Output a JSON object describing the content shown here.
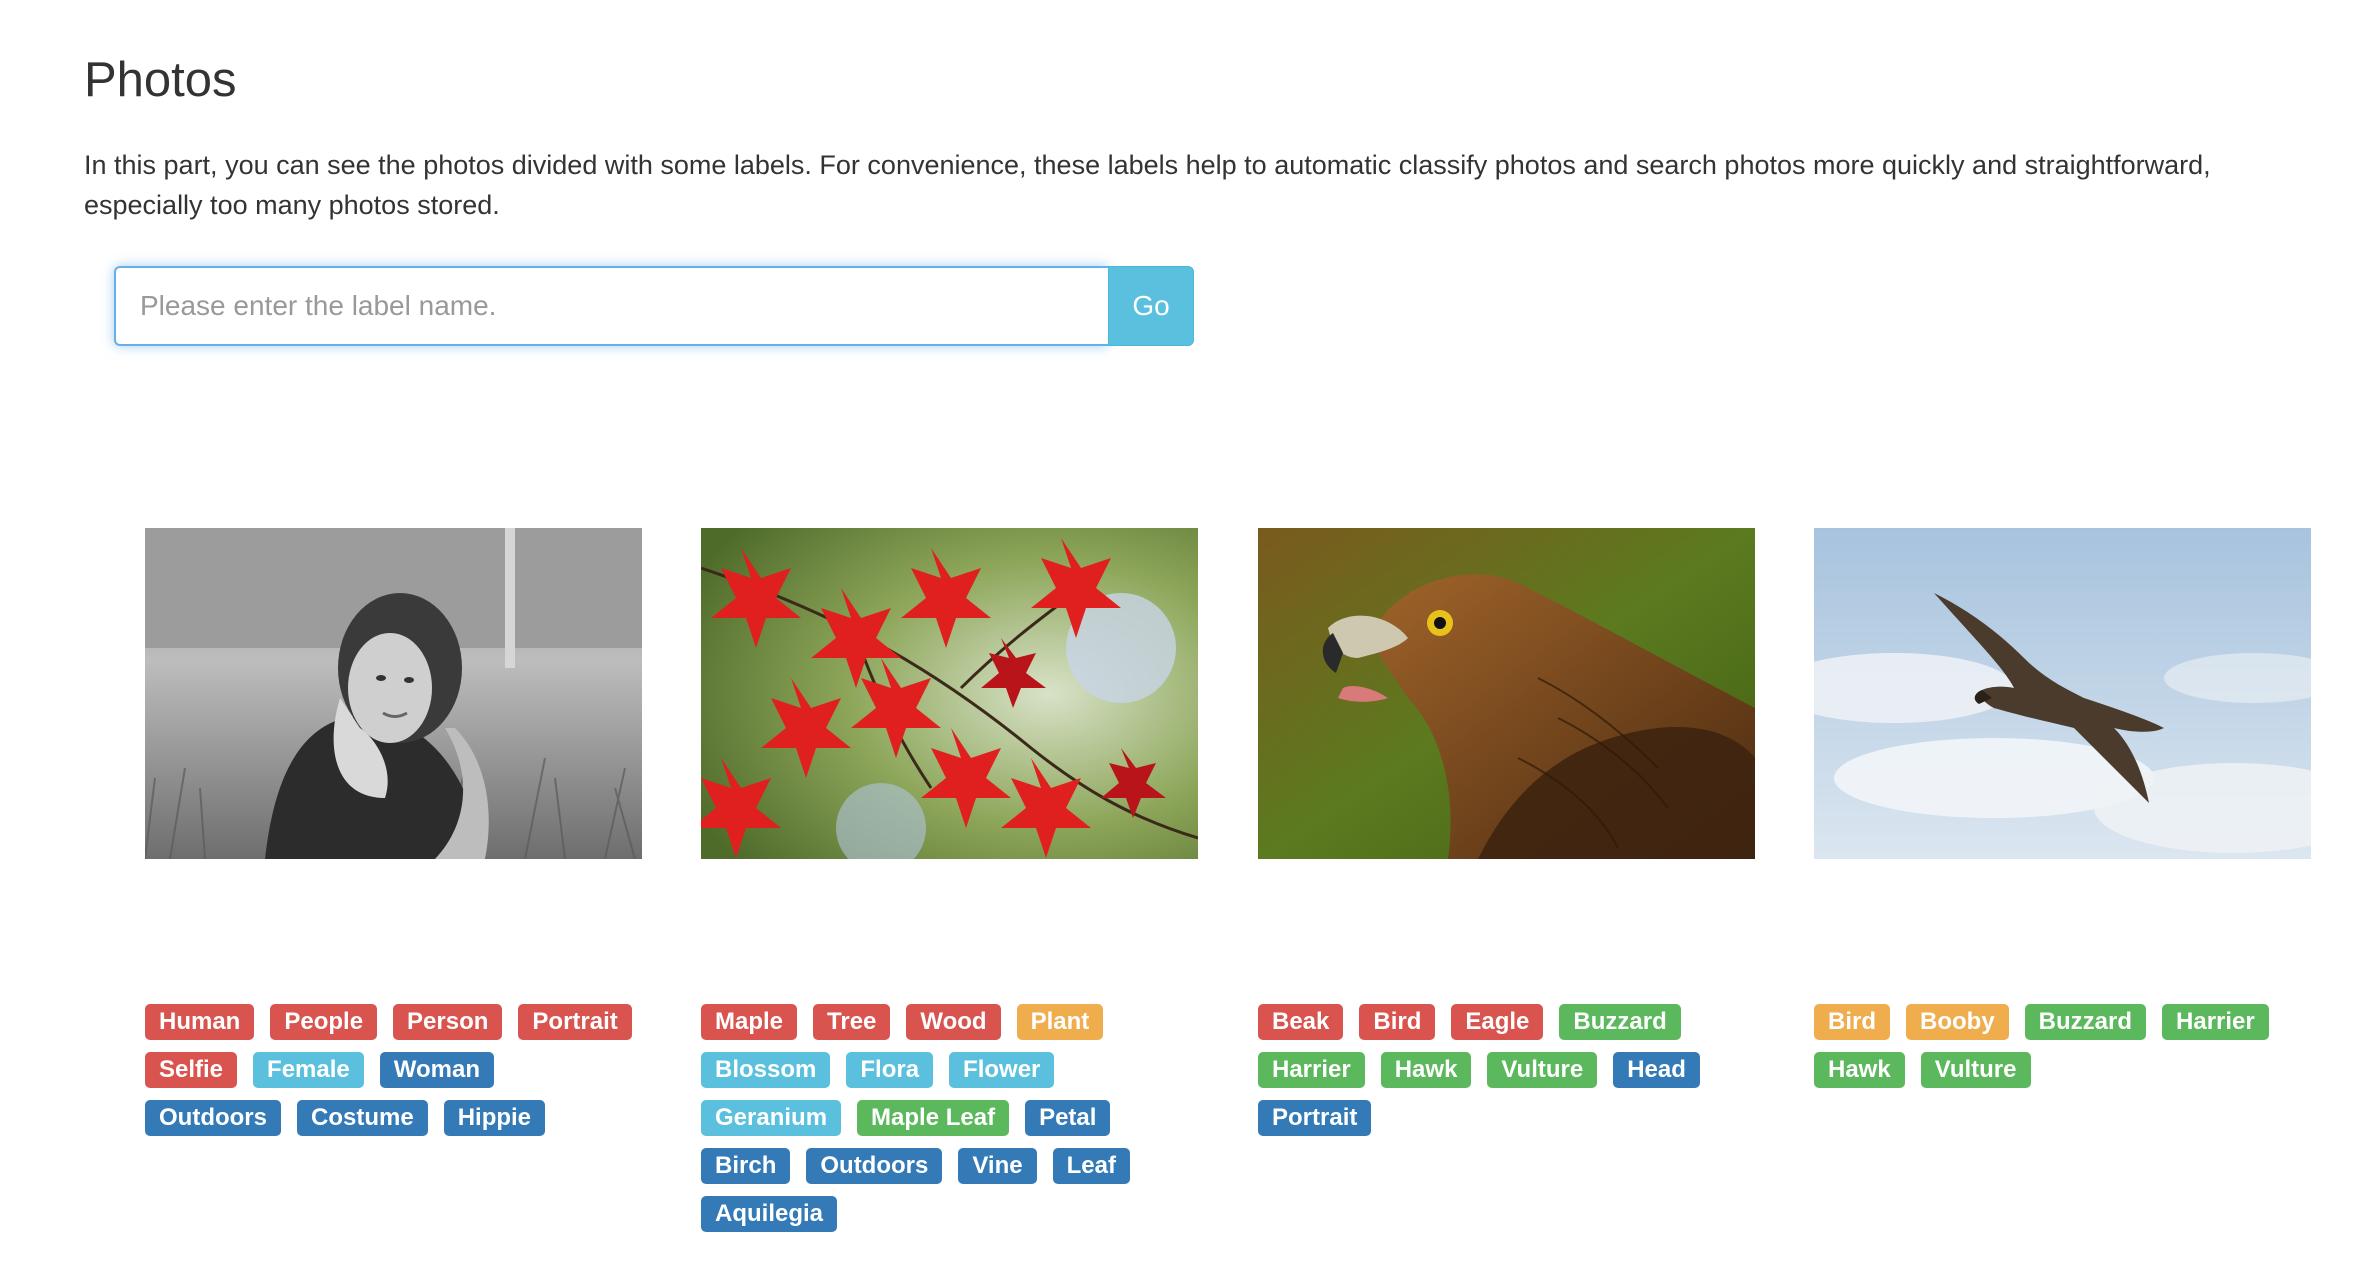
{
  "page": {
    "title": "Photos",
    "intro": "In this part, you can see the photos divided with some labels. For convenience, these labels help to automatic classify photos and search photos more quickly and straightforward, especially too many photos stored."
  },
  "search": {
    "placeholder": "Please enter the label name.",
    "button_label": "Go"
  },
  "colors": {
    "danger": "#d9534f",
    "info": "#5bc0de",
    "primary": "#337ab7",
    "warning": "#f0ad4e",
    "success": "#5cb85c"
  },
  "photos": [
    {
      "subject": "woman-lying-in-grass",
      "labels": [
        {
          "text": "Human",
          "style": "danger"
        },
        {
          "text": "People",
          "style": "danger"
        },
        {
          "text": "Person",
          "style": "danger"
        },
        {
          "text": "Portrait",
          "style": "danger"
        },
        {
          "text": "Selfie",
          "style": "danger"
        },
        {
          "text": "Female",
          "style": "info"
        },
        {
          "text": "Woman",
          "style": "primary"
        },
        {
          "text": "Outdoors",
          "style": "primary"
        },
        {
          "text": "Costume",
          "style": "primary"
        },
        {
          "text": "Hippie",
          "style": "primary"
        }
      ]
    },
    {
      "subject": "red-maple-leaves",
      "labels": [
        {
          "text": "Maple",
          "style": "danger"
        },
        {
          "text": "Tree",
          "style": "danger"
        },
        {
          "text": "Wood",
          "style": "danger"
        },
        {
          "text": "Plant",
          "style": "warning"
        },
        {
          "text": "Blossom",
          "style": "info"
        },
        {
          "text": "Flora",
          "style": "info"
        },
        {
          "text": "Flower",
          "style": "info"
        },
        {
          "text": "Geranium",
          "style": "info"
        },
        {
          "text": "Maple Leaf",
          "style": "success"
        },
        {
          "text": "Petal",
          "style": "primary"
        },
        {
          "text": "Birch",
          "style": "primary"
        },
        {
          "text": "Outdoors",
          "style": "primary"
        },
        {
          "text": "Vine",
          "style": "primary"
        },
        {
          "text": "Leaf",
          "style": "primary"
        },
        {
          "text": "Aquilegia",
          "style": "primary"
        }
      ]
    },
    {
      "subject": "eagle-head",
      "labels": [
        {
          "text": "Beak",
          "style": "danger"
        },
        {
          "text": "Bird",
          "style": "danger"
        },
        {
          "text": "Eagle",
          "style": "danger"
        },
        {
          "text": "Buzzard",
          "style": "success"
        },
        {
          "text": "Harrier",
          "style": "success"
        },
        {
          "text": "Hawk",
          "style": "success"
        },
        {
          "text": "Vulture",
          "style": "success"
        },
        {
          "text": "Head",
          "style": "primary"
        },
        {
          "text": "Portrait",
          "style": "primary"
        }
      ]
    },
    {
      "subject": "bird-flying-in-sky",
      "labels": [
        {
          "text": "Bird",
          "style": "warning"
        },
        {
          "text": "Booby",
          "style": "warning"
        },
        {
          "text": "Buzzard",
          "style": "success"
        },
        {
          "text": "Harrier",
          "style": "success"
        },
        {
          "text": "Hawk",
          "style": "success"
        },
        {
          "text": "Vulture",
          "style": "success"
        }
      ]
    }
  ]
}
